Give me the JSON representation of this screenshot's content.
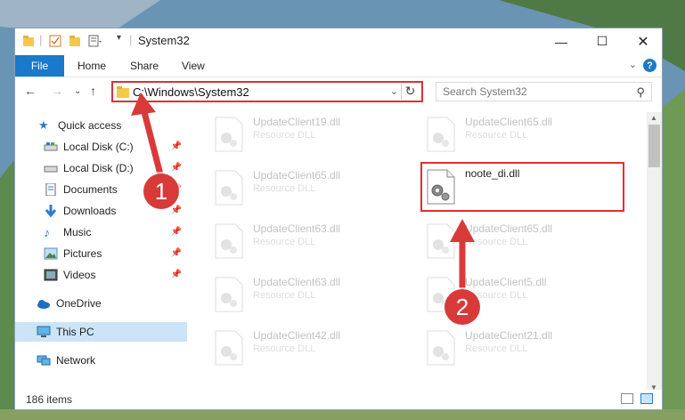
{
  "window": {
    "title": "System32"
  },
  "ribbon": {
    "file_tab": "File",
    "tabs": [
      "Home",
      "Share",
      "View"
    ]
  },
  "address": {
    "path": "C:\\Windows\\System32",
    "search_placeholder": "Search System32"
  },
  "navpane": {
    "items": [
      {
        "label": "Quick access",
        "icon": "star-icon"
      },
      {
        "label": "Local Disk (C:)",
        "icon": "drive-icon",
        "pinned": true
      },
      {
        "label": "Local Disk (D:)",
        "icon": "drive-icon",
        "pinned": true
      },
      {
        "label": "Documents",
        "icon": "documents-icon",
        "pinned": true
      },
      {
        "label": "Downloads",
        "icon": "download-icon",
        "pinned": true
      },
      {
        "label": "Music",
        "icon": "music-icon",
        "pinned": true
      },
      {
        "label": "Pictures",
        "icon": "pictures-icon",
        "pinned": true
      },
      {
        "label": "Videos",
        "icon": "videos-icon",
        "pinned": true
      },
      {
        "label": "OneDrive",
        "icon": "cloud-icon"
      },
      {
        "label": "This PC",
        "icon": "computer-icon",
        "selected": true
      },
      {
        "label": "Network",
        "icon": "network-icon"
      }
    ]
  },
  "files": [
    {
      "name": "UpdateClient19.dll",
      "type": "Resource DLL"
    },
    {
      "name": "UpdateClient65.dll",
      "type": "Resource DLL"
    },
    {
      "name": "UpdateClient65.dll",
      "type": "Resource DLL"
    },
    {
      "name": "noote_di.dll",
      "type": ""
    },
    {
      "name": "UpdateClient63.dll",
      "type": "Resource DLL"
    },
    {
      "name": "UpdateClient65.dll",
      "type": "Resource DLL"
    },
    {
      "name": "UpdateClient63.dll",
      "type": "Resource DLL"
    },
    {
      "name": "UpdateClient5.dll",
      "type": "Resource DLL"
    },
    {
      "name": "UpdateClient42.dll",
      "type": "Resource DLL"
    },
    {
      "name": "UpdateClient21.dll",
      "type": "Resource DLL"
    }
  ],
  "status": {
    "item_count": "186 items"
  },
  "callouts": {
    "one": "1",
    "two": "2"
  },
  "colors": {
    "accent": "#1979ca",
    "highlight": "#e03030",
    "callout": "#d83a3a"
  }
}
